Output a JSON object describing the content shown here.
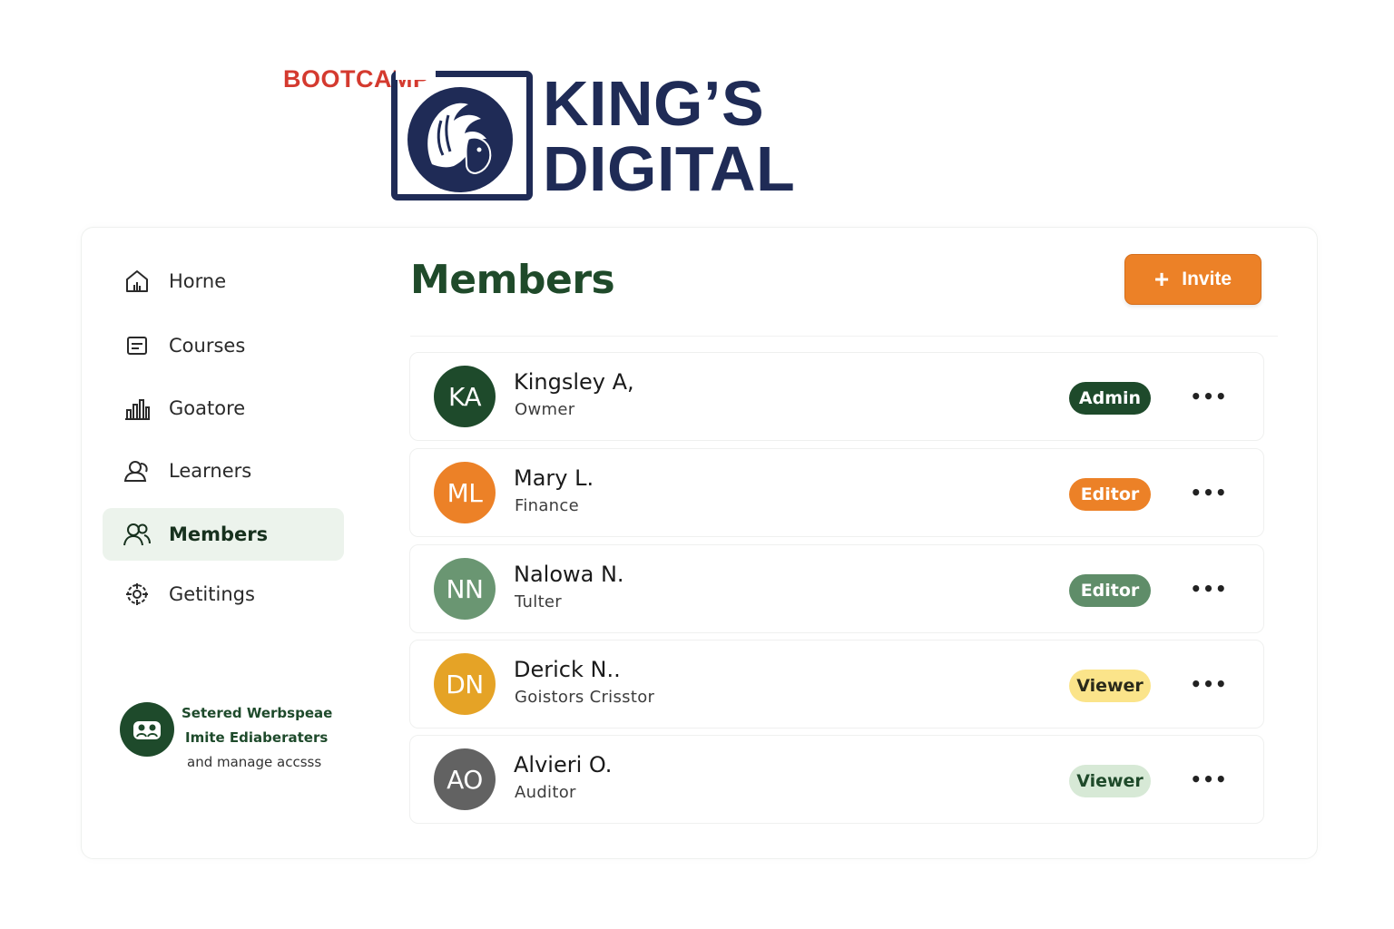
{
  "brand": {
    "tag": "BOOTCAMP",
    "line1": "KING’S",
    "line2": "DIGITAL",
    "logo_icon": "lion-head-icon",
    "colors": {
      "navy": "#1f2b56",
      "tag_red": "#d43a2f"
    }
  },
  "sidebar": {
    "items": [
      {
        "label": "Horne",
        "icon": "home-icon",
        "active": false
      },
      {
        "label": "Courses",
        "icon": "courses-icon",
        "active": false
      },
      {
        "label": "Goatore",
        "icon": "bar-chart-icon",
        "active": false
      },
      {
        "label": "Learners",
        "icon": "learners-icon",
        "active": false
      },
      {
        "label": "Members",
        "icon": "members-icon",
        "active": true
      },
      {
        "label": "Getitings",
        "icon": "settings-gear-icon",
        "active": false
      }
    ],
    "promo": {
      "line1": "Setered Werbspeae",
      "line2": "Imite Ediaberaters",
      "line3": "and manage accsss",
      "icon": "team-icon"
    }
  },
  "main": {
    "title": "Members",
    "invite_label": "Invite",
    "members": [
      {
        "initials": "KA",
        "name": "Kingsley A,",
        "role": "Owmer",
        "badge": "Admin",
        "avatar_color": "#1e4a2b",
        "badge_bg": "#1e4a2b",
        "badge_fg": "#ffffff",
        "more": "•••"
      },
      {
        "initials": "ML",
        "name": "Mary L.",
        "role": "Finance",
        "badge": "Editor",
        "avatar_color": "#ec8127",
        "badge_bg": "#ec8127",
        "badge_fg": "#ffffff",
        "more": "•••"
      },
      {
        "initials": "NN",
        "name": "Nalowa N.",
        "role": "Tulter",
        "badge": "Editor",
        "avatar_color": "#6a9672",
        "badge_bg": "#5f8d69",
        "badge_fg": "#ffffff",
        "more": "•••"
      },
      {
        "initials": "DN",
        "name": "Derick N..",
        "role": "Goistors Crisstor",
        "badge": "Viewer",
        "avatar_color": "#e5a326",
        "badge_bg": "#fbe48a",
        "badge_fg": "#2a2a1a",
        "more": "•••"
      },
      {
        "initials": "AO",
        "name": "Alvieri O.",
        "role": "Auditor",
        "badge": "Viewer",
        "avatar_color": "#626262",
        "badge_bg": "#d7e9d6",
        "badge_fg": "#1f4a2a",
        "more": "•••"
      }
    ]
  }
}
